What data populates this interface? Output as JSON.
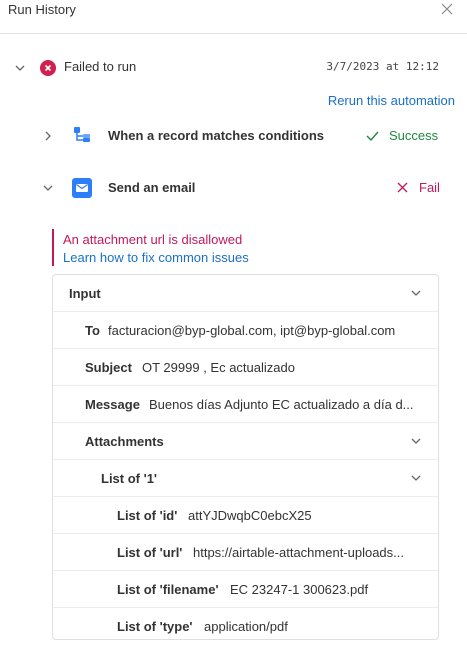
{
  "header": {
    "title": "Run History"
  },
  "run": {
    "status": "Failed to run",
    "date": "3/7/2023 at 12:12",
    "rerun_label": "Rerun this automation"
  },
  "steps": [
    {
      "label": "When a record matches conditions",
      "status": "Success"
    },
    {
      "label": "Send an email",
      "status": "Fail"
    }
  ],
  "error": {
    "message": "An attachment url is disallowed",
    "link": "Learn how to fix common issues"
  },
  "input": {
    "title": "Input",
    "to": {
      "key": "To",
      "value": "facturacion@byp-global.com, ipt@byp-global.com"
    },
    "subject": {
      "key": "Subject",
      "value": "OT 29999 , Ec actualizado"
    },
    "message": {
      "key": "Message",
      "value": "Buenos días Adjunto EC actualizado a día d..."
    },
    "attachments": {
      "key": "Attachments"
    },
    "list": {
      "key": "List of '1'"
    },
    "id": {
      "key": "List of 'id'",
      "value": "attYJDwqbC0ebcX25"
    },
    "url": {
      "key": "List of 'url'",
      "value": "https://airtable-attachment-uploads..."
    },
    "filename": {
      "key": "List of 'filename'",
      "value": "EC 23247-1 300623.pdf"
    },
    "type": {
      "key": "List of 'type'",
      "value": "application/pdf"
    }
  },
  "colors": {
    "accent": "#1a6fc9",
    "error": "#c2185b",
    "success": "#1e8a3c"
  },
  "icons": [
    "close-icon",
    "chevron-down-icon",
    "chevron-right-icon",
    "error-circle-icon",
    "trigger-icon",
    "email-icon",
    "check-icon",
    "x-icon"
  ]
}
